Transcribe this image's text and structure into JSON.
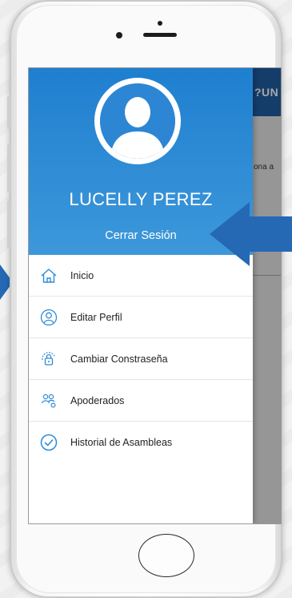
{
  "drawer": {
    "user_name": "LUCELLY PEREZ",
    "logout_label": "Cerrar Sesión",
    "items": [
      {
        "label": "Inicio",
        "icon": "home-icon"
      },
      {
        "label": "Editar Perfil",
        "icon": "profile-icon"
      },
      {
        "label": "Cambiar Constraseña",
        "icon": "lock-icon"
      },
      {
        "label": "Apoderados",
        "icon": "users-icon"
      },
      {
        "label": "Historial de Asambleas",
        "icon": "check-circle-icon"
      }
    ]
  },
  "background_app": {
    "logo_text": "?UN",
    "partial_text": "ona a"
  },
  "colors": {
    "header_top": "#1f7fd0",
    "header_bottom": "#3d98da",
    "icon_blue": "#2b8bd8",
    "arrow_blue": "#2569b4"
  }
}
